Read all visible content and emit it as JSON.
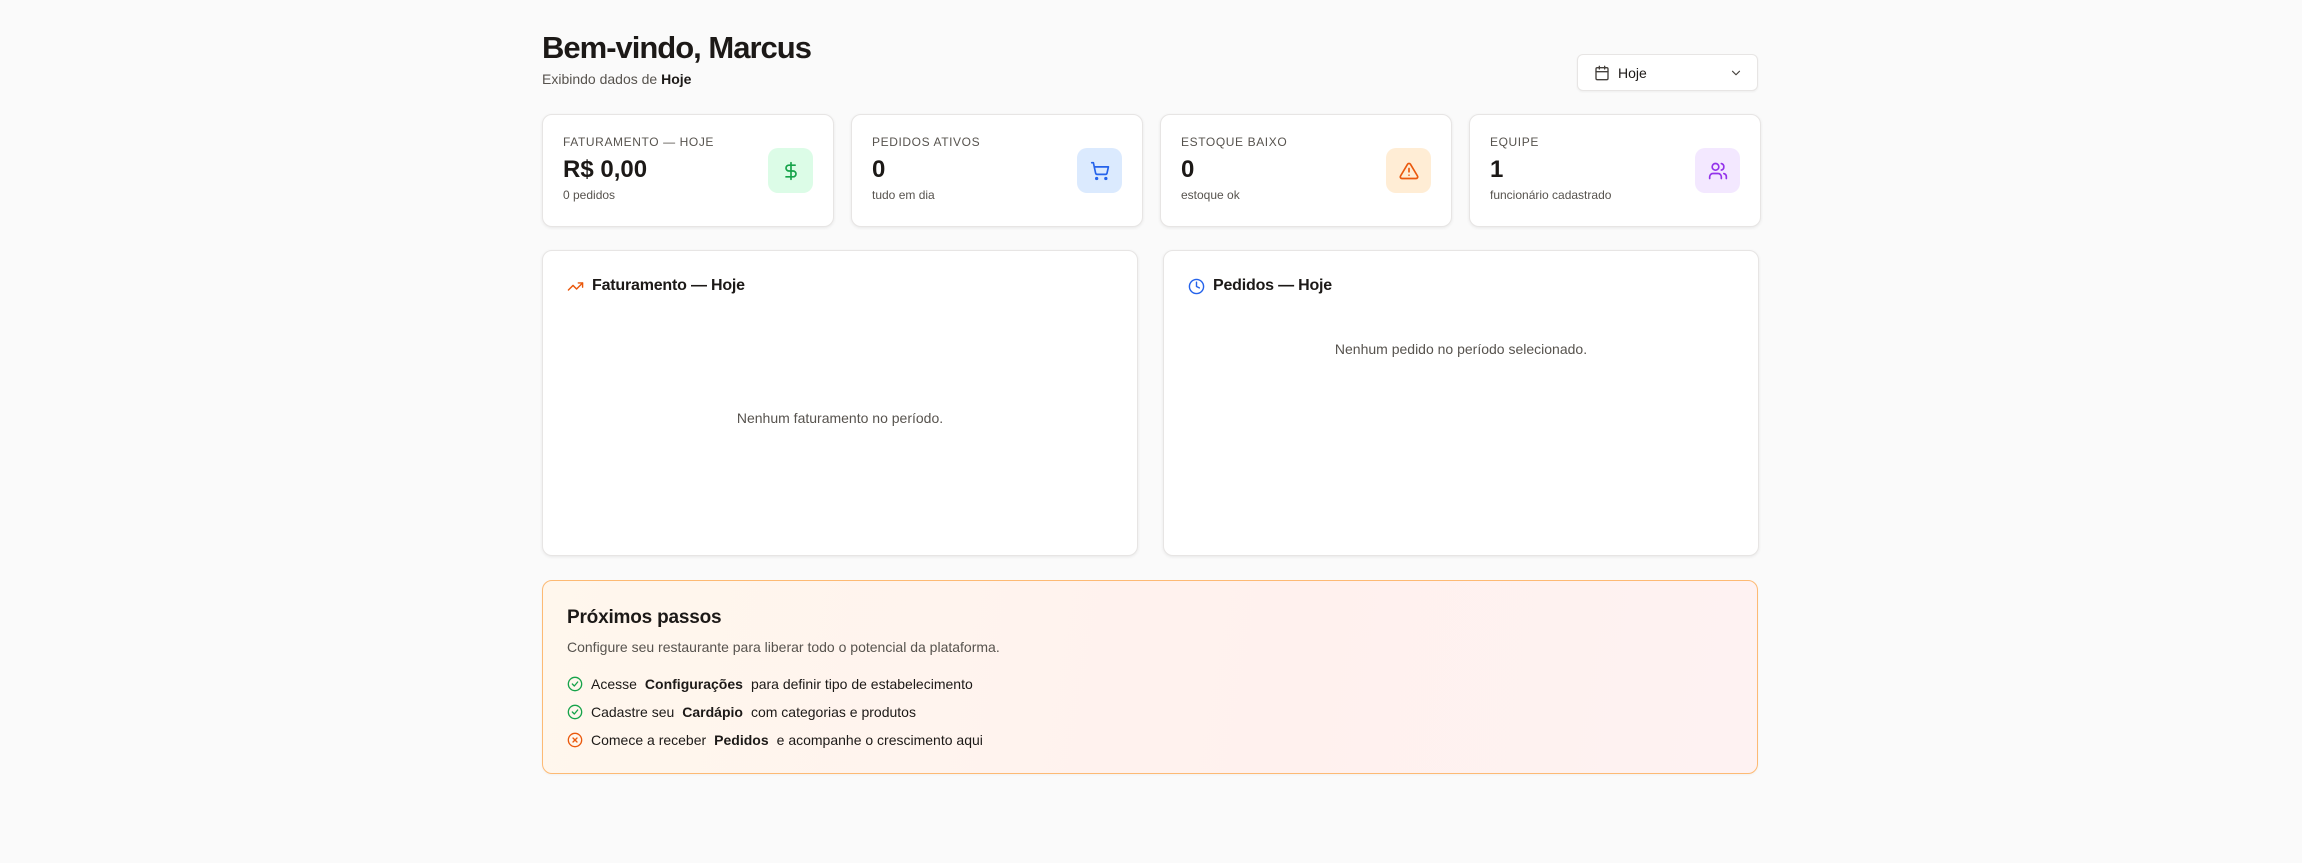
{
  "header": {
    "welcome": "Bem-vindo, Marcus",
    "subtitle_prefix": "Exibindo dados de",
    "subtitle_period": "Hoje",
    "period_select": {
      "value": "Hoje",
      "icon": "calendar-icon"
    }
  },
  "stats": [
    {
      "label": "FATURAMENTO — HOJE",
      "value": "R$ 0,00",
      "sub": "0 pedidos",
      "icon": "dollar-icon",
      "color": "#16a34a"
    },
    {
      "label": "PEDIDOS ATIVOS",
      "value": "0",
      "sub": "tudo em dia",
      "icon": "cart-icon",
      "color": "#2563eb"
    },
    {
      "label": "ESTOQUE BAIXO",
      "value": "0",
      "sub": "estoque ok",
      "icon": "alert-triangle-icon",
      "color": "#ea580c"
    },
    {
      "label": "EQUIPE",
      "value": "1",
      "sub": "funcionário cadastrado",
      "icon": "users-icon",
      "color": "#9333ea"
    }
  ],
  "panels": {
    "revenue": {
      "title": "Faturamento — Hoje",
      "empty": "Nenhum faturamento no período.",
      "icon": "trending-up-icon",
      "color": "#ea580c"
    },
    "orders": {
      "title": "Pedidos — Hoje",
      "empty": "Nenhum pedido no período selecionado.",
      "icon": "clock-icon",
      "color": "#2563eb"
    }
  },
  "next_steps": {
    "title": "Próximos passos",
    "description": "Configure seu restaurante para liberar todo o potencial da plataforma.",
    "items": [
      {
        "before": "Acesse",
        "bold": "Configurações",
        "after": "para definir tipo de estabelecimento",
        "status": "done",
        "icon": "check-circle-icon",
        "color": "#16a34a"
      },
      {
        "before": "Cadastre seu",
        "bold": "Cardápio",
        "after": "com categorias e produtos",
        "status": "done",
        "icon": "check-circle-icon",
        "color": "#16a34a"
      },
      {
        "before": "Comece a receber",
        "bold": "Pedidos",
        "after": "e acompanhe o crescimento aqui",
        "status": "pending",
        "icon": "x-circle-icon",
        "color": "#ea580c"
      }
    ]
  }
}
